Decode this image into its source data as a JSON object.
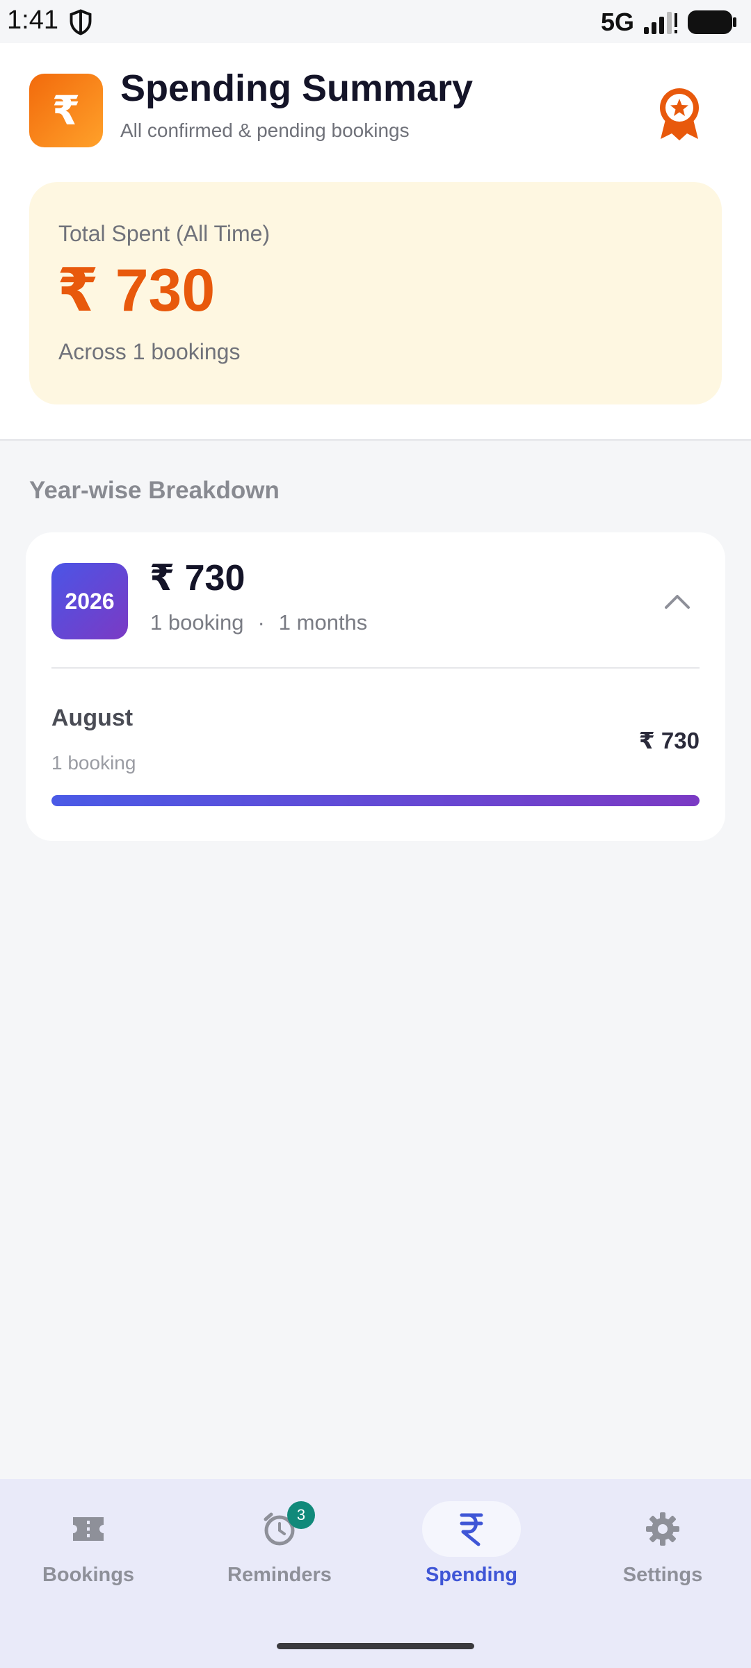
{
  "status_bar": {
    "time": "1:41",
    "network": "5G"
  },
  "header": {
    "logo_symbol": "₹",
    "title": "Spending Summary",
    "subtitle": "All confirmed & pending bookings",
    "award_icon": "award-ribbon-icon"
  },
  "total_card": {
    "label": "Total Spent (All Time)",
    "amount": "₹ 730",
    "bookings_text": "Across 1 bookings"
  },
  "breakdown": {
    "section_title": "Year-wise Breakdown",
    "years": [
      {
        "year": "2026",
        "amount": "₹ 730",
        "bookings": "1 booking",
        "separator": "·",
        "months": "1 months",
        "expanded": true,
        "month_rows": [
          {
            "name": "August",
            "count": "1 booking",
            "amount": "₹ 730",
            "share": 1.0
          }
        ]
      }
    ]
  },
  "bottom_nav": {
    "items": [
      {
        "label": "Bookings",
        "icon": "ticket-icon",
        "active": false
      },
      {
        "label": "Reminders",
        "icon": "alarm-clock-icon",
        "active": false,
        "badge": "3"
      },
      {
        "label": "Spending",
        "icon": "rupee-icon",
        "active": true
      },
      {
        "label": "Settings",
        "icon": "gear-icon",
        "active": false
      }
    ]
  },
  "colors": {
    "accent_orange": "#e8590c",
    "accent_blue": "#3f56d6",
    "accent_purple": "#7b3ac4",
    "badge_teal": "#11897a"
  }
}
